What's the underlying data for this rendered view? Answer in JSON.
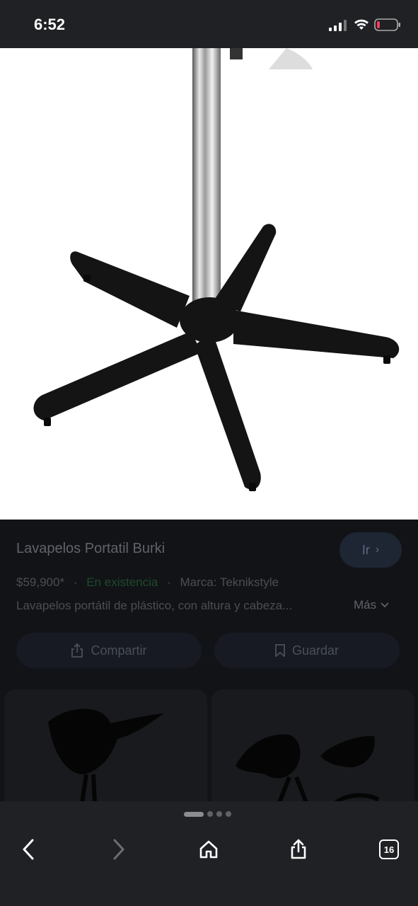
{
  "status_bar": {
    "time": "6:52"
  },
  "product": {
    "title": "Lavapelos Portatil Burki",
    "go_label": "Ir",
    "price": "$59,900*",
    "stock": "En existencia",
    "brand": "Marca: Teknikstyle",
    "description": "Lavapelos portátil de plástico, con altura y cabeza...",
    "more_label": "Más"
  },
  "actions": {
    "share_label": "Compartir",
    "save_label": "Guardar"
  },
  "browser": {
    "tab_count": "16"
  },
  "colors": {
    "accent_stock": "#1d4a2b",
    "go_button": "#1e2533"
  },
  "icons": [
    "signal-icon",
    "wifi-icon",
    "battery-icon",
    "chevron-right-icon",
    "chevron-down-icon",
    "share-icon",
    "bookmark-icon",
    "back-icon",
    "forward-icon",
    "home-icon",
    "share-page-icon",
    "tabs-icon"
  ]
}
